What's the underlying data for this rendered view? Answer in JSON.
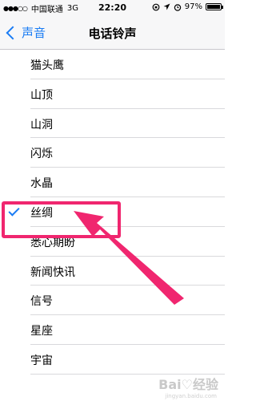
{
  "status_bar": {
    "signal": "●●●○○",
    "carrier": "中国联通",
    "network": "3G",
    "time": "22:20",
    "battery_percent": "97%",
    "battery_level": 0.97
  },
  "nav": {
    "back_label": "声音",
    "title": "电话铃声"
  },
  "ringtones": [
    {
      "label": "猫头鹰",
      "selected": false
    },
    {
      "label": "山顶",
      "selected": false
    },
    {
      "label": "山洞",
      "selected": false
    },
    {
      "label": "闪烁",
      "selected": false
    },
    {
      "label": "水晶",
      "selected": false
    },
    {
      "label": "丝绸",
      "selected": true
    },
    {
      "label": "悉心期盼",
      "selected": false
    },
    {
      "label": "新闻快讯",
      "selected": false
    },
    {
      "label": "信号",
      "selected": false
    },
    {
      "label": "星座",
      "selected": false
    },
    {
      "label": "宇宙",
      "selected": false
    }
  ],
  "watermark": {
    "text": "Bai♡经验",
    "sub": "jingyan.baidu.com"
  },
  "colors": {
    "accent": "#1a7cf4",
    "annotation": "#f0266f"
  }
}
